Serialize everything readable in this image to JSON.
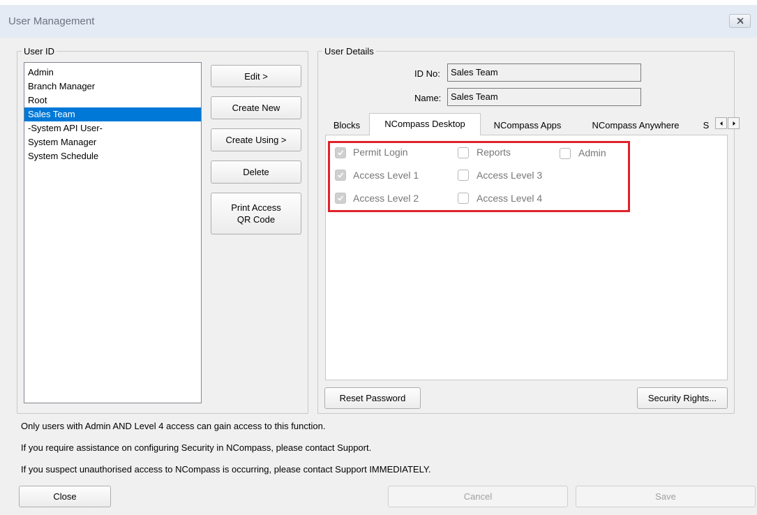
{
  "window": {
    "title": "User Management",
    "close_icon": "close-x-icon"
  },
  "user_id_group": {
    "legend": "User ID",
    "users": [
      {
        "label": "Admin",
        "selected": false
      },
      {
        "label": "Branch Manager",
        "selected": false
      },
      {
        "label": "Root",
        "selected": false
      },
      {
        "label": "Sales Team",
        "selected": true
      },
      {
        "label": "-System API User-",
        "selected": false
      },
      {
        "label": "System Manager",
        "selected": false
      },
      {
        "label": "System Schedule",
        "selected": false
      }
    ]
  },
  "actions": {
    "edit": "Edit >",
    "create_new": "Create New",
    "create_using": "Create Using >",
    "delete": "Delete",
    "print_access_line1": "Print Access",
    "print_access_line2": "QR Code"
  },
  "user_details": {
    "legend": "User Details",
    "id_label": "ID No:",
    "id_value": "Sales Team",
    "name_label": "Name:",
    "name_value": "Sales Team"
  },
  "tabs": {
    "items": [
      "Blocks",
      "NCompass Desktop",
      "NCompass Apps",
      "NCompass Anywhere",
      "S"
    ],
    "active": "NCompass Desktop",
    "scroll_left_icon": "arrow-left-icon",
    "scroll_right_icon": "arrow-right-icon"
  },
  "permissions": {
    "permit_login": {
      "label": "Permit Login",
      "checked": true
    },
    "access_level_1": {
      "label": "Access Level 1",
      "checked": true
    },
    "access_level_2": {
      "label": "Access Level 2",
      "checked": true
    },
    "reports": {
      "label": "Reports",
      "checked": false
    },
    "access_level_3": {
      "label": "Access Level 3",
      "checked": false
    },
    "access_level_4": {
      "label": "Access Level 4",
      "checked": false
    },
    "admin": {
      "label": "Admin",
      "checked": false
    },
    "highlight_color": "#e0222b"
  },
  "details_buttons": {
    "reset_password": "Reset Password",
    "security_rights": "Security Rights..."
  },
  "info": {
    "line1": "Only users with Admin AND Level 4 access can gain access to this function.",
    "line2": "If you require assistance on configuring Security in NCompass, please contact Support.",
    "line3": "If you suspect unauthorised access to NCompass is occurring, please contact Support IMMEDIATELY."
  },
  "footer": {
    "close": "Close",
    "cancel": "Cancel",
    "save": "Save"
  },
  "colors": {
    "selection": "#0078d7",
    "titlebar": "#e4ebf5",
    "dialog_bg": "#f0f0f0"
  }
}
